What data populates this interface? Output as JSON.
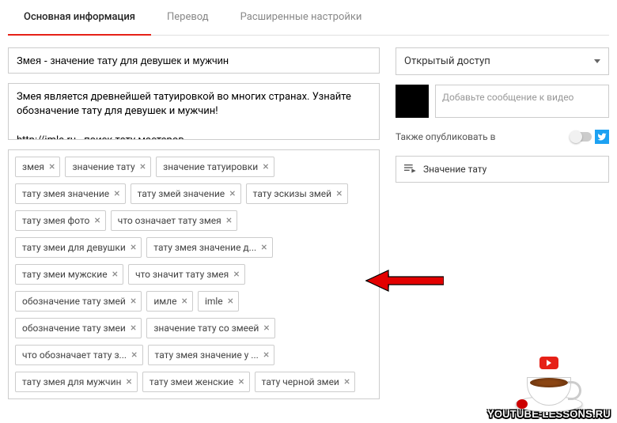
{
  "tabs": {
    "main": "Основная информация",
    "translate": "Перевод",
    "advanced": "Расширенные настройки"
  },
  "title": "Змея - значение тату для девушек и мужчин",
  "description": "Змея является древнейшей татуировкой во многих странах. Узнайте обозначение тату для девушек и мужчин!\n\nhttp://imle.ru - поиск тату мастеров",
  "tags": [
    "змея",
    "значение тату",
    "значение татуировки",
    "тату змея значение",
    "тату змей значение",
    "тату эскизы змей",
    "тату змея фото",
    "что означает тату змея",
    "тату змеи для девушки",
    "тату змея значение д...",
    "тату змеи мужские",
    "что значит тату змея",
    "обозначение тату змей",
    "имле",
    "imle",
    "обозначение тату змеи",
    "значение тату со змеей",
    "что обозначает тату з...",
    "тату змея значение у ...",
    "тату змея для мужчин",
    "тату змеи женские",
    "тату черной змеи"
  ],
  "privacy": "Открытый доступ",
  "message_placeholder": "Добавьте сообщение к видео",
  "also_publish": "Также опубликовать в",
  "playlist": "Значение тату",
  "watermark": "YOUTUBE-LESSONS.RU"
}
